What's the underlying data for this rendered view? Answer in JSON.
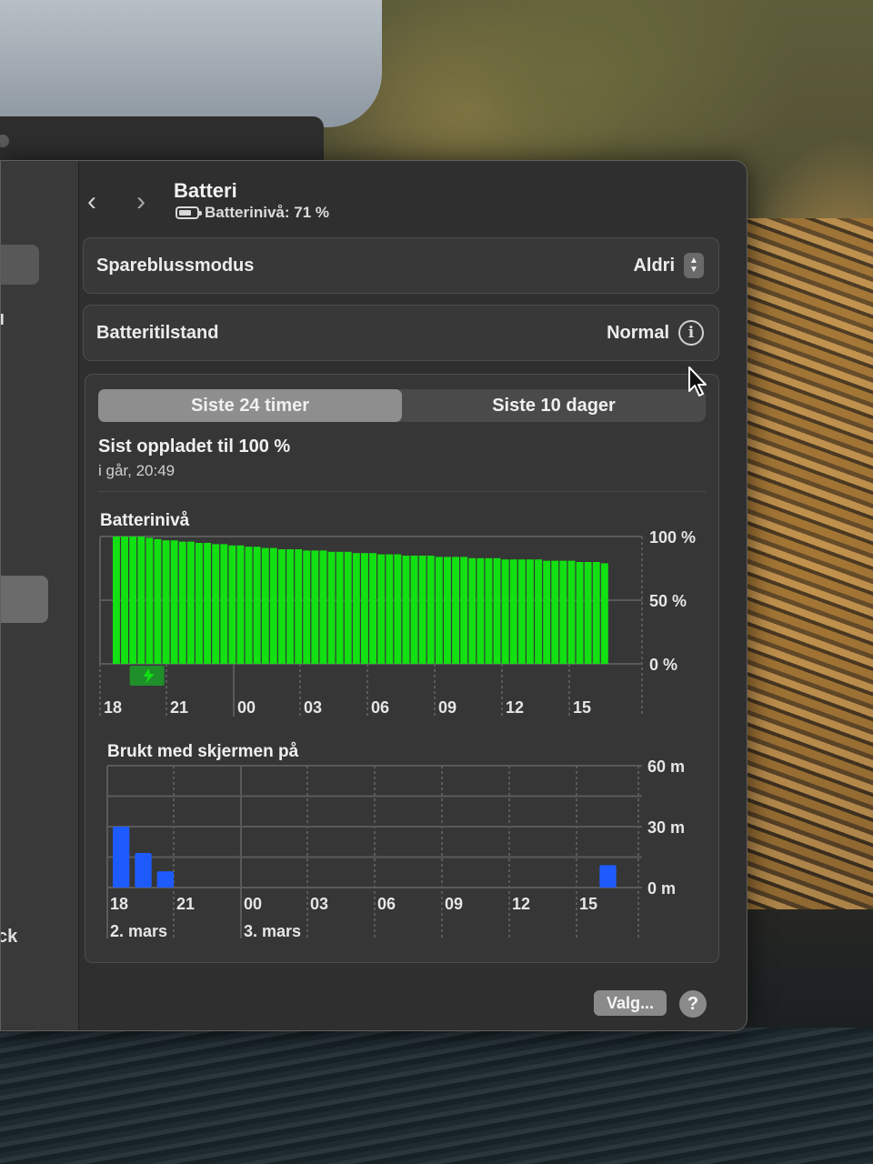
{
  "header": {
    "back_icon": "chevron-left-icon",
    "forward_icon": "chevron-right-icon",
    "title": "Batteri",
    "subtitle": "Batterinivå: 71 %"
  },
  "low_power_mode": {
    "label": "Spareblussmodus",
    "value": "Aldri"
  },
  "battery_health": {
    "label": "Batteritilstand",
    "value": "Normal"
  },
  "tabs": [
    {
      "label": "Siste 24 timer",
      "active": true
    },
    {
      "label": "Siste 10 dager",
      "active": false
    }
  ],
  "last_charged": {
    "title": "Sist oppladet til 100 %",
    "time": "i går, 20:49"
  },
  "footer": {
    "options_label": "Valg...",
    "help_label": "?"
  },
  "colors": {
    "battery_bar": "#12e012",
    "screen_bar": "#1e5bff",
    "charge_marker": "#1f8f2a"
  },
  "chart_data": [
    {
      "type": "bar",
      "title": "Batterinivå",
      "x_tick_labels": [
        "18",
        "21",
        "00",
        "03",
        "06",
        "09",
        "12",
        "15"
      ],
      "y_tick_labels": [
        "100 %",
        "50 %",
        "0 %"
      ],
      "ylim": [
        0,
        100
      ],
      "unit": "%",
      "grid": true,
      "charging_marker_near_hour": "20",
      "values": [
        100,
        100,
        100,
        100,
        99,
        98,
        97,
        97,
        96,
        96,
        95,
        95,
        94,
        94,
        93,
        93,
        92,
        92,
        91,
        91,
        90,
        90,
        90,
        89,
        89,
        89,
        88,
        88,
        88,
        87,
        87,
        87,
        86,
        86,
        86,
        85,
        85,
        85,
        85,
        84,
        84,
        84,
        84,
        83,
        83,
        83,
        83,
        82,
        82,
        82,
        82,
        82,
        81,
        81,
        81,
        81,
        80,
        80,
        80,
        79
      ]
    },
    {
      "type": "bar",
      "title": "Brukt med skjermen på",
      "x_tick_labels": [
        "18",
        "21",
        "00",
        "03",
        "06",
        "09",
        "12",
        "15"
      ],
      "date_labels": [
        "2. mars",
        "3. mars"
      ],
      "y_tick_labels": [
        "60 m",
        "30 m",
        "0 m"
      ],
      "ylim": [
        0,
        60
      ],
      "unit": "m",
      "grid": true,
      "bars": [
        {
          "hour": "18",
          "value": 30
        },
        {
          "hour": "19",
          "value": 17
        },
        {
          "hour": "20",
          "value": 8
        },
        {
          "hour": "16",
          "value": 11
        }
      ]
    }
  ]
}
